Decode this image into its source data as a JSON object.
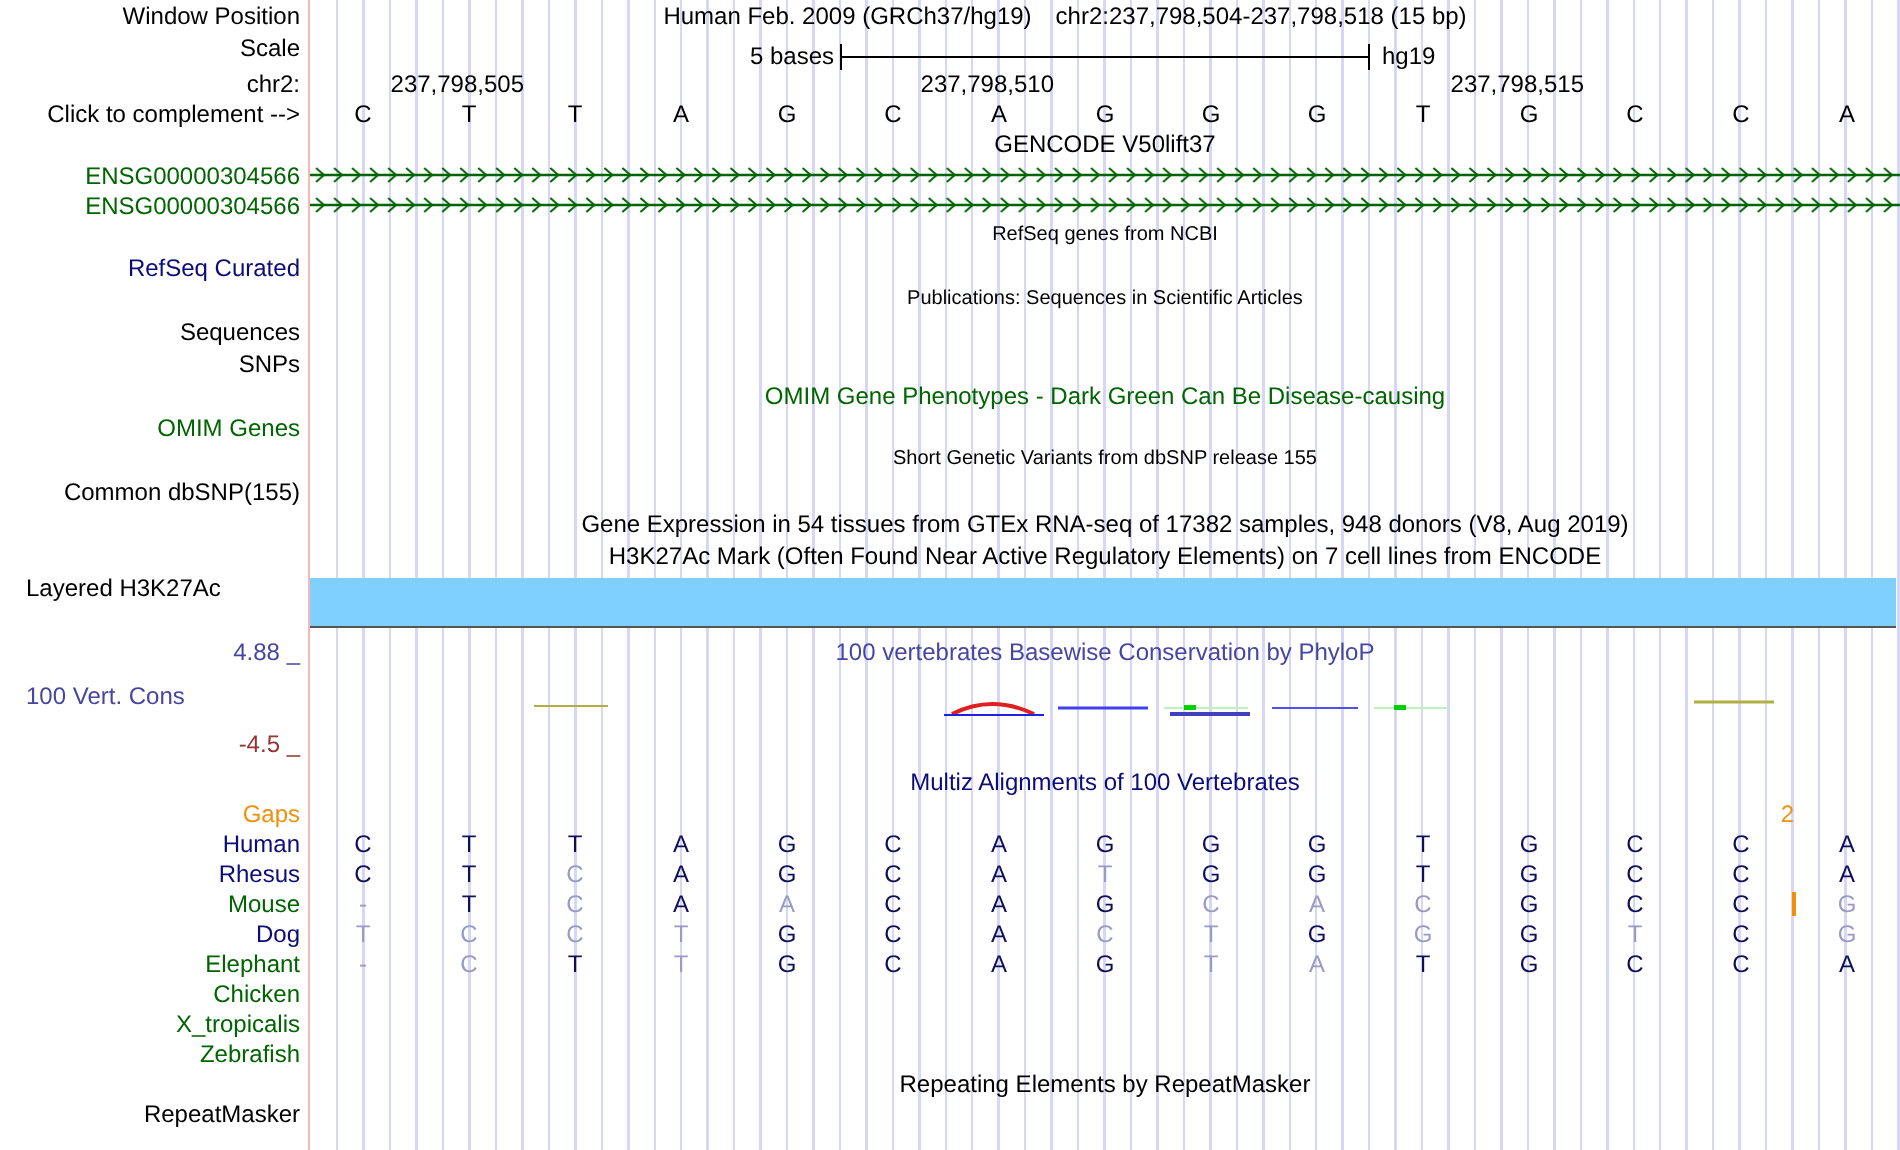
{
  "header": {
    "label": "Window Position",
    "assembly": "Human Feb. 2009 (GRCh37/hg19)",
    "position": "chr2:237,798,504-237,798,518 (15 bp)"
  },
  "scale": {
    "label": "Scale",
    "length": "5 bases",
    "assembly": "hg19"
  },
  "ruler": {
    "label": "chr2:",
    "ticks": [
      {
        "text": "237,798,505",
        "kind": "col1"
      },
      {
        "text": "237,798,510",
        "kind": "col6"
      },
      {
        "text": "237,798,515",
        "kind": "col11"
      }
    ]
  },
  "sequence": {
    "label": "Click to complement -->",
    "bases": [
      "C",
      "T",
      "T",
      "A",
      "G",
      "C",
      "A",
      "G",
      "G",
      "G",
      "T",
      "G",
      "C",
      "C",
      "A"
    ]
  },
  "tracks": [
    {
      "kind": "title",
      "text": "GENCODE V50lift37",
      "color": "#000000"
    },
    {
      "kind": "gene",
      "label": "ENSG00000304566"
    },
    {
      "kind": "gene",
      "label": "ENSG00000304566"
    },
    {
      "kind": "note",
      "text": "RefSeq genes from NCBI",
      "color": "#000000"
    },
    {
      "kind": "label",
      "label": "RefSeq Curated",
      "color": "#0c0c78"
    },
    {
      "kind": "note",
      "text": "Publications: Sequences in Scientific Articles",
      "color": "#000000"
    },
    {
      "kind": "label",
      "label": "Sequences",
      "color": "#000000"
    },
    {
      "kind": "label",
      "label": "SNPs",
      "color": "#000000"
    },
    {
      "kind": "title",
      "text": "OMIM Gene Phenotypes - Dark Green Can Be Disease-causing",
      "color": "#006400"
    },
    {
      "kind": "label",
      "label": "OMIM Genes",
      "color": "#006400"
    },
    {
      "kind": "note",
      "text": "Short Genetic Variants from dbSNP release 155",
      "color": "#000000"
    },
    {
      "kind": "label",
      "label": "Common dbSNP(155)",
      "color": "#000000"
    },
    {
      "kind": "title",
      "text": "Gene Expression in 54 tissues from GTEx RNA-seq of 17382 samples, 948 donors (V8, Aug 2019)",
      "color": "#000000"
    },
    {
      "kind": "title",
      "text": "H3K27Ac Mark (Often Found Near Active Regulatory Elements) on 7 cell lines from ENCODE",
      "color": "#000000"
    },
    {
      "kind": "bar",
      "label": "Layered H3K27Ac"
    },
    {
      "kind": "conservation",
      "title": "100 vertebrates Basewise Conservation by PhyloP",
      "label": "100 Vert. Cons",
      "max": "4.88 _",
      "min": "-4.5 _"
    },
    {
      "kind": "title",
      "text": "Multiz Alignments of 100 Vertebrates",
      "color": "#0c0c78"
    },
    {
      "kind": "gaps",
      "label": "Gaps",
      "count": "2"
    }
  ],
  "species": [
    {
      "name": "Human",
      "color": "#0c0c78",
      "bases": [
        {
          "b": "C",
          "match": true
        },
        {
          "b": "T",
          "match": true
        },
        {
          "b": "T",
          "match": true
        },
        {
          "b": "A",
          "match": true
        },
        {
          "b": "G",
          "match": true
        },
        {
          "b": "C",
          "match": true
        },
        {
          "b": "A",
          "match": true
        },
        {
          "b": "G",
          "match": true
        },
        {
          "b": "G",
          "match": true
        },
        {
          "b": "G",
          "match": true
        },
        {
          "b": "T",
          "match": true
        },
        {
          "b": "G",
          "match": true
        },
        {
          "b": "C",
          "match": true
        },
        {
          "b": "C",
          "match": true
        },
        {
          "b": "A",
          "match": true
        }
      ]
    },
    {
      "name": "Rhesus",
      "color": "#0c0c78",
      "bases": [
        {
          "b": "C",
          "match": true
        },
        {
          "b": "T",
          "match": true
        },
        {
          "b": "C",
          "match": false
        },
        {
          "b": "A",
          "match": true
        },
        {
          "b": "G",
          "match": true
        },
        {
          "b": "C",
          "match": true
        },
        {
          "b": "A",
          "match": true
        },
        {
          "b": "T",
          "match": false
        },
        {
          "b": "G",
          "match": true
        },
        {
          "b": "G",
          "match": true
        },
        {
          "b": "T",
          "match": true
        },
        {
          "b": "G",
          "match": true
        },
        {
          "b": "C",
          "match": true
        },
        {
          "b": "C",
          "match": true
        },
        {
          "b": "A",
          "match": true
        }
      ]
    },
    {
      "name": "Mouse",
      "color": "#006400",
      "insertion": true,
      "bases": [
        {
          "b": "-",
          "match": false
        },
        {
          "b": "T",
          "match": true
        },
        {
          "b": "C",
          "match": false
        },
        {
          "b": "A",
          "match": true
        },
        {
          "b": "A",
          "match": false
        },
        {
          "b": "C",
          "match": true
        },
        {
          "b": "A",
          "match": true
        },
        {
          "b": "G",
          "match": true
        },
        {
          "b": "C",
          "match": false
        },
        {
          "b": "A",
          "match": false
        },
        {
          "b": "C",
          "match": false
        },
        {
          "b": "G",
          "match": true
        },
        {
          "b": "C",
          "match": true
        },
        {
          "b": "C",
          "match": true
        },
        {
          "b": "G",
          "match": false
        }
      ]
    },
    {
      "name": "Dog",
      "color": "#0c0c78",
      "bases": [
        {
          "b": "T",
          "match": false
        },
        {
          "b": "C",
          "match": false
        },
        {
          "b": "C",
          "match": false
        },
        {
          "b": "T",
          "match": false
        },
        {
          "b": "G",
          "match": true
        },
        {
          "b": "C",
          "match": true
        },
        {
          "b": "A",
          "match": true
        },
        {
          "b": "C",
          "match": false
        },
        {
          "b": "T",
          "match": false
        },
        {
          "b": "G",
          "match": true
        },
        {
          "b": "G",
          "match": false
        },
        {
          "b": "G",
          "match": true
        },
        {
          "b": "T",
          "match": false
        },
        {
          "b": "C",
          "match": true
        },
        {
          "b": "G",
          "match": false
        }
      ]
    },
    {
      "name": "Elephant",
      "color": "#006400",
      "bases": [
        {
          "b": "-",
          "match": false
        },
        {
          "b": "C",
          "match": false
        },
        {
          "b": "T",
          "match": true
        },
        {
          "b": "T",
          "match": false
        },
        {
          "b": "G",
          "match": true
        },
        {
          "b": "C",
          "match": true
        },
        {
          "b": "A",
          "match": true
        },
        {
          "b": "G",
          "match": true
        },
        {
          "b": "T",
          "match": false
        },
        {
          "b": "A",
          "match": false
        },
        {
          "b": "T",
          "match": true
        },
        {
          "b": "G",
          "match": true
        },
        {
          "b": "C",
          "match": true
        },
        {
          "b": "C",
          "match": true
        },
        {
          "b": "A",
          "match": true
        }
      ]
    },
    {
      "name": "Chicken",
      "color": "#006400"
    },
    {
      "name": "X_tropicalis",
      "color": "#006400"
    },
    {
      "name": "Zebrafish",
      "color": "#006400"
    }
  ],
  "repeats": {
    "title": "Repeating Elements by RepeatMasker",
    "label": "RepeatMasker"
  }
}
